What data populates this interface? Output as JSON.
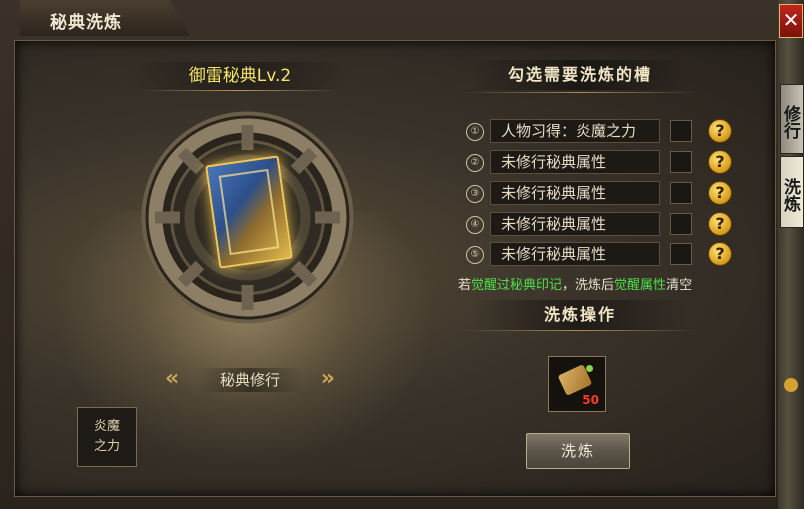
{
  "window": {
    "title": "秘典洗炼",
    "close_label": "✕",
    "side_tabs": [
      "修行",
      "洗炼"
    ]
  },
  "left": {
    "book_title": "御雷秘典Lv.2",
    "cultivate_label": "秘典修行",
    "skill_box": [
      "炎魔",
      "之力"
    ]
  },
  "right": {
    "select_heading": "勾选需要洗炼的槽",
    "slots": [
      {
        "num": "①",
        "text": "人物习得：炎魔之力"
      },
      {
        "num": "②",
        "text": "未修行秘典属性"
      },
      {
        "num": "③",
        "text": "未修行秘典属性"
      },
      {
        "num": "④",
        "text": "未修行秘典属性"
      },
      {
        "num": "⑤",
        "text": "未修行秘典属性"
      }
    ],
    "help_glyph": "?",
    "warning": {
      "p1": "若",
      "g1": "觉醒过秘典印记",
      "p2": "，洗炼后",
      "g2": "觉醒属性",
      "p3": "清空"
    },
    "operation_heading": "洗炼操作",
    "material_count": "50",
    "wash_button": "洗炼"
  },
  "colors": {
    "title_yellow": "#f5e66a",
    "warning_green": "#4fe04a",
    "count_red": "#ff3a2a",
    "close_red": "#c0251d"
  }
}
